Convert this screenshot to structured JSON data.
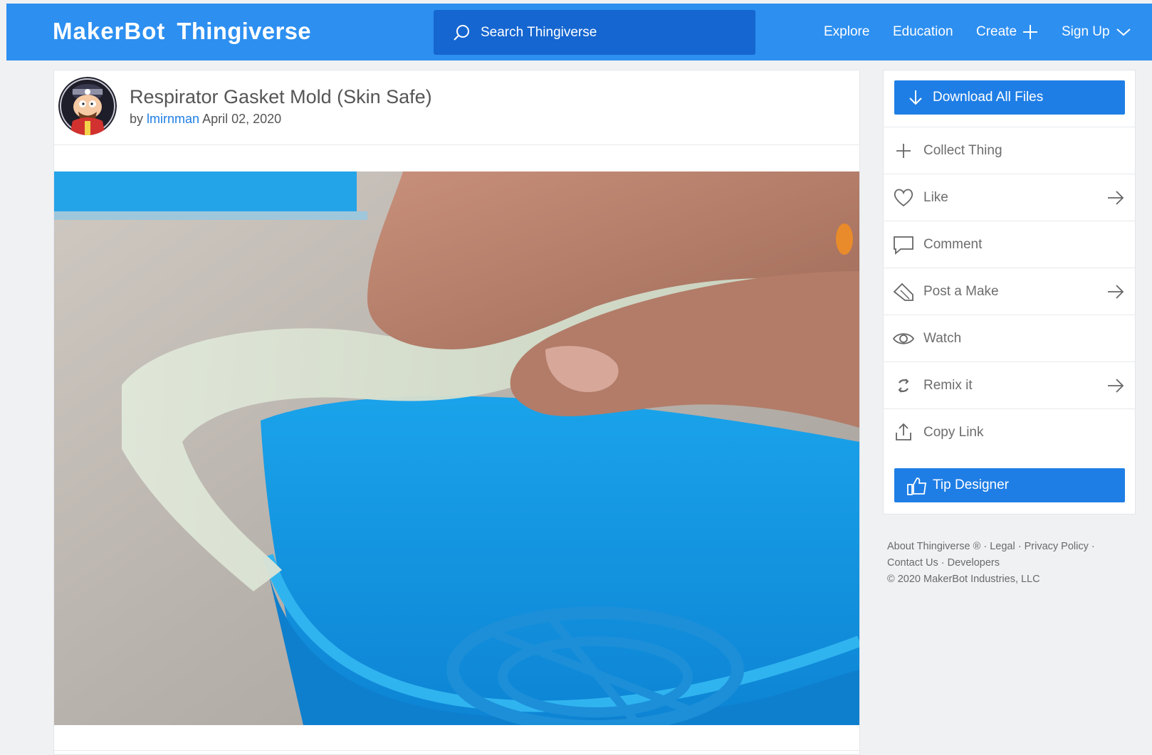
{
  "header": {
    "logo_brand": "MakerBot",
    "logo_product": "Thingiverse",
    "search_placeholder": "Search Thingiverse",
    "nav": {
      "explore": "Explore",
      "education": "Education",
      "create": "Create",
      "signup": "Sign Up"
    },
    "color": "#2d8ff0",
    "search_color": "#1566d0"
  },
  "thing": {
    "title": "Respirator Gasket Mold (Skin Safe)",
    "by": "by",
    "author": "lmirnman",
    "date": "April 02, 2020"
  },
  "sidebar": {
    "download_label": "Download All Files",
    "tip_label": "Tip Designer",
    "actions": [
      {
        "label": "Collect Thing",
        "icon": "plus-icon"
      },
      {
        "label": "Like",
        "icon": "heart-icon"
      },
      {
        "label": "Comment",
        "icon": "comment-icon"
      },
      {
        "label": "Post a Make",
        "icon": "make-icon"
      },
      {
        "label": "Watch",
        "icon": "eye-icon"
      },
      {
        "label": "Remix it",
        "icon": "remix-icon"
      },
      {
        "label": "Copy Link",
        "icon": "share-icon"
      }
    ],
    "accent": "#1f7ee5"
  },
  "footer": {
    "about": "About Thingiverse ®",
    "legal": "Legal",
    "privacy": "Privacy Policy",
    "contact": "Contact Us",
    "developers": "Developers",
    "copyright": "©  2020 MakerBot Industries, LLC",
    "sep": " · "
  }
}
